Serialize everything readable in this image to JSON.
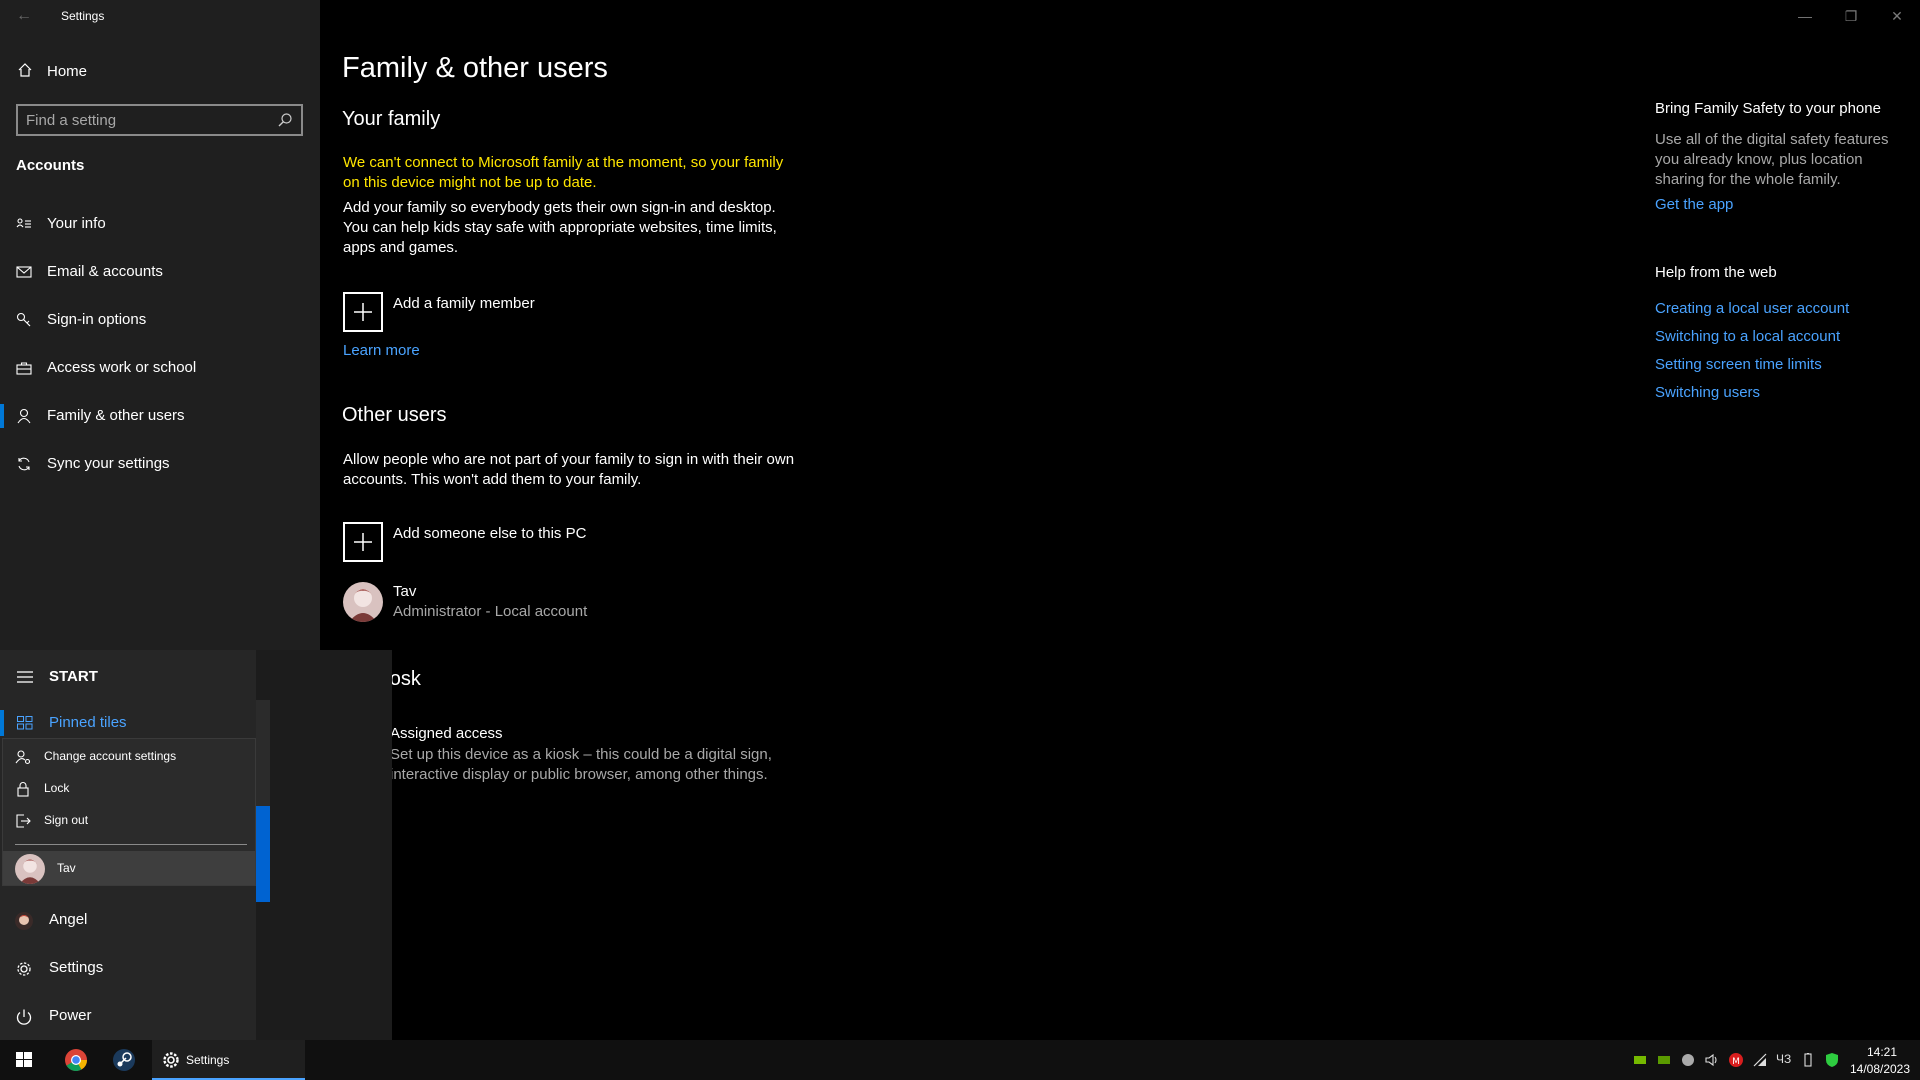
{
  "window": {
    "title": "Settings",
    "back": "←",
    "minimize": "—",
    "restore": "❐",
    "close": "✕"
  },
  "sidebar": {
    "home_label": "Home",
    "search_placeholder": "Find a setting",
    "section": "Accounts",
    "items": [
      {
        "label": "Your info",
        "icon": "contact-card-icon"
      },
      {
        "label": "Email & accounts",
        "icon": "mail-icon"
      },
      {
        "label": "Sign-in options",
        "icon": "key-icon"
      },
      {
        "label": "Access work or school",
        "icon": "briefcase-icon"
      },
      {
        "label": "Family & other users",
        "icon": "person-icon",
        "active": true
      },
      {
        "label": "Sync your settings",
        "icon": "sync-icon"
      }
    ]
  },
  "main": {
    "page_title": "Family & other users",
    "your_family": {
      "heading": "Your family",
      "warning": "We can't connect to Microsoft family at the moment, so your family on this device might not be up to date.",
      "description": "Add your family so everybody gets their own sign-in and desktop. You can help kids stay safe with appropriate websites, time limits, apps and games.",
      "add_label": "Add a family member",
      "learn_more": "Learn more"
    },
    "other_users": {
      "heading": "Other users",
      "description": "Allow people who are not part of your family to sign in with their own accounts. This won't add them to your family.",
      "add_label": "Add someone else to this PC",
      "user_name": "Tav",
      "user_role": "Administrator - Local account"
    },
    "kiosk": {
      "heading": "o a kiosk",
      "assigned_title": "Assigned access",
      "assigned_desc": "Set up this device as a kiosk – this could be a digital sign, interactive display or public browser, among other things."
    }
  },
  "side_panel": {
    "phone_heading": "Bring Family Safety to your phone",
    "phone_text": "Use all of the digital safety features you already know, plus location sharing for the whole family.",
    "get_app": "Get the app",
    "help_heading": "Help from the web",
    "help_links": [
      "Creating a local user account",
      "Switching to a local account",
      "Setting screen time limits",
      "Switching users"
    ]
  },
  "start_menu": {
    "header": "START",
    "pinned": "Pinned tiles",
    "flyout": {
      "change_account": "Change account settings",
      "lock": "Lock",
      "sign_out": "Sign out",
      "user": "Tav"
    },
    "items": [
      {
        "label": "Angel",
        "icon": "user-avatar-icon"
      },
      {
        "label": "Settings",
        "icon": "gear-icon"
      },
      {
        "label": "Power",
        "icon": "power-icon"
      }
    ]
  },
  "taskbar": {
    "settings_label": "Settings",
    "time": "14:21",
    "date": "14/08/2023",
    "tray_text": "ЧЗ"
  },
  "colors": {
    "accent": "#0078d7",
    "link": "#4aa3ff",
    "warning": "#ffe600",
    "sidebar_bg": "#1f1f1f",
    "main_bg": "#000000"
  }
}
